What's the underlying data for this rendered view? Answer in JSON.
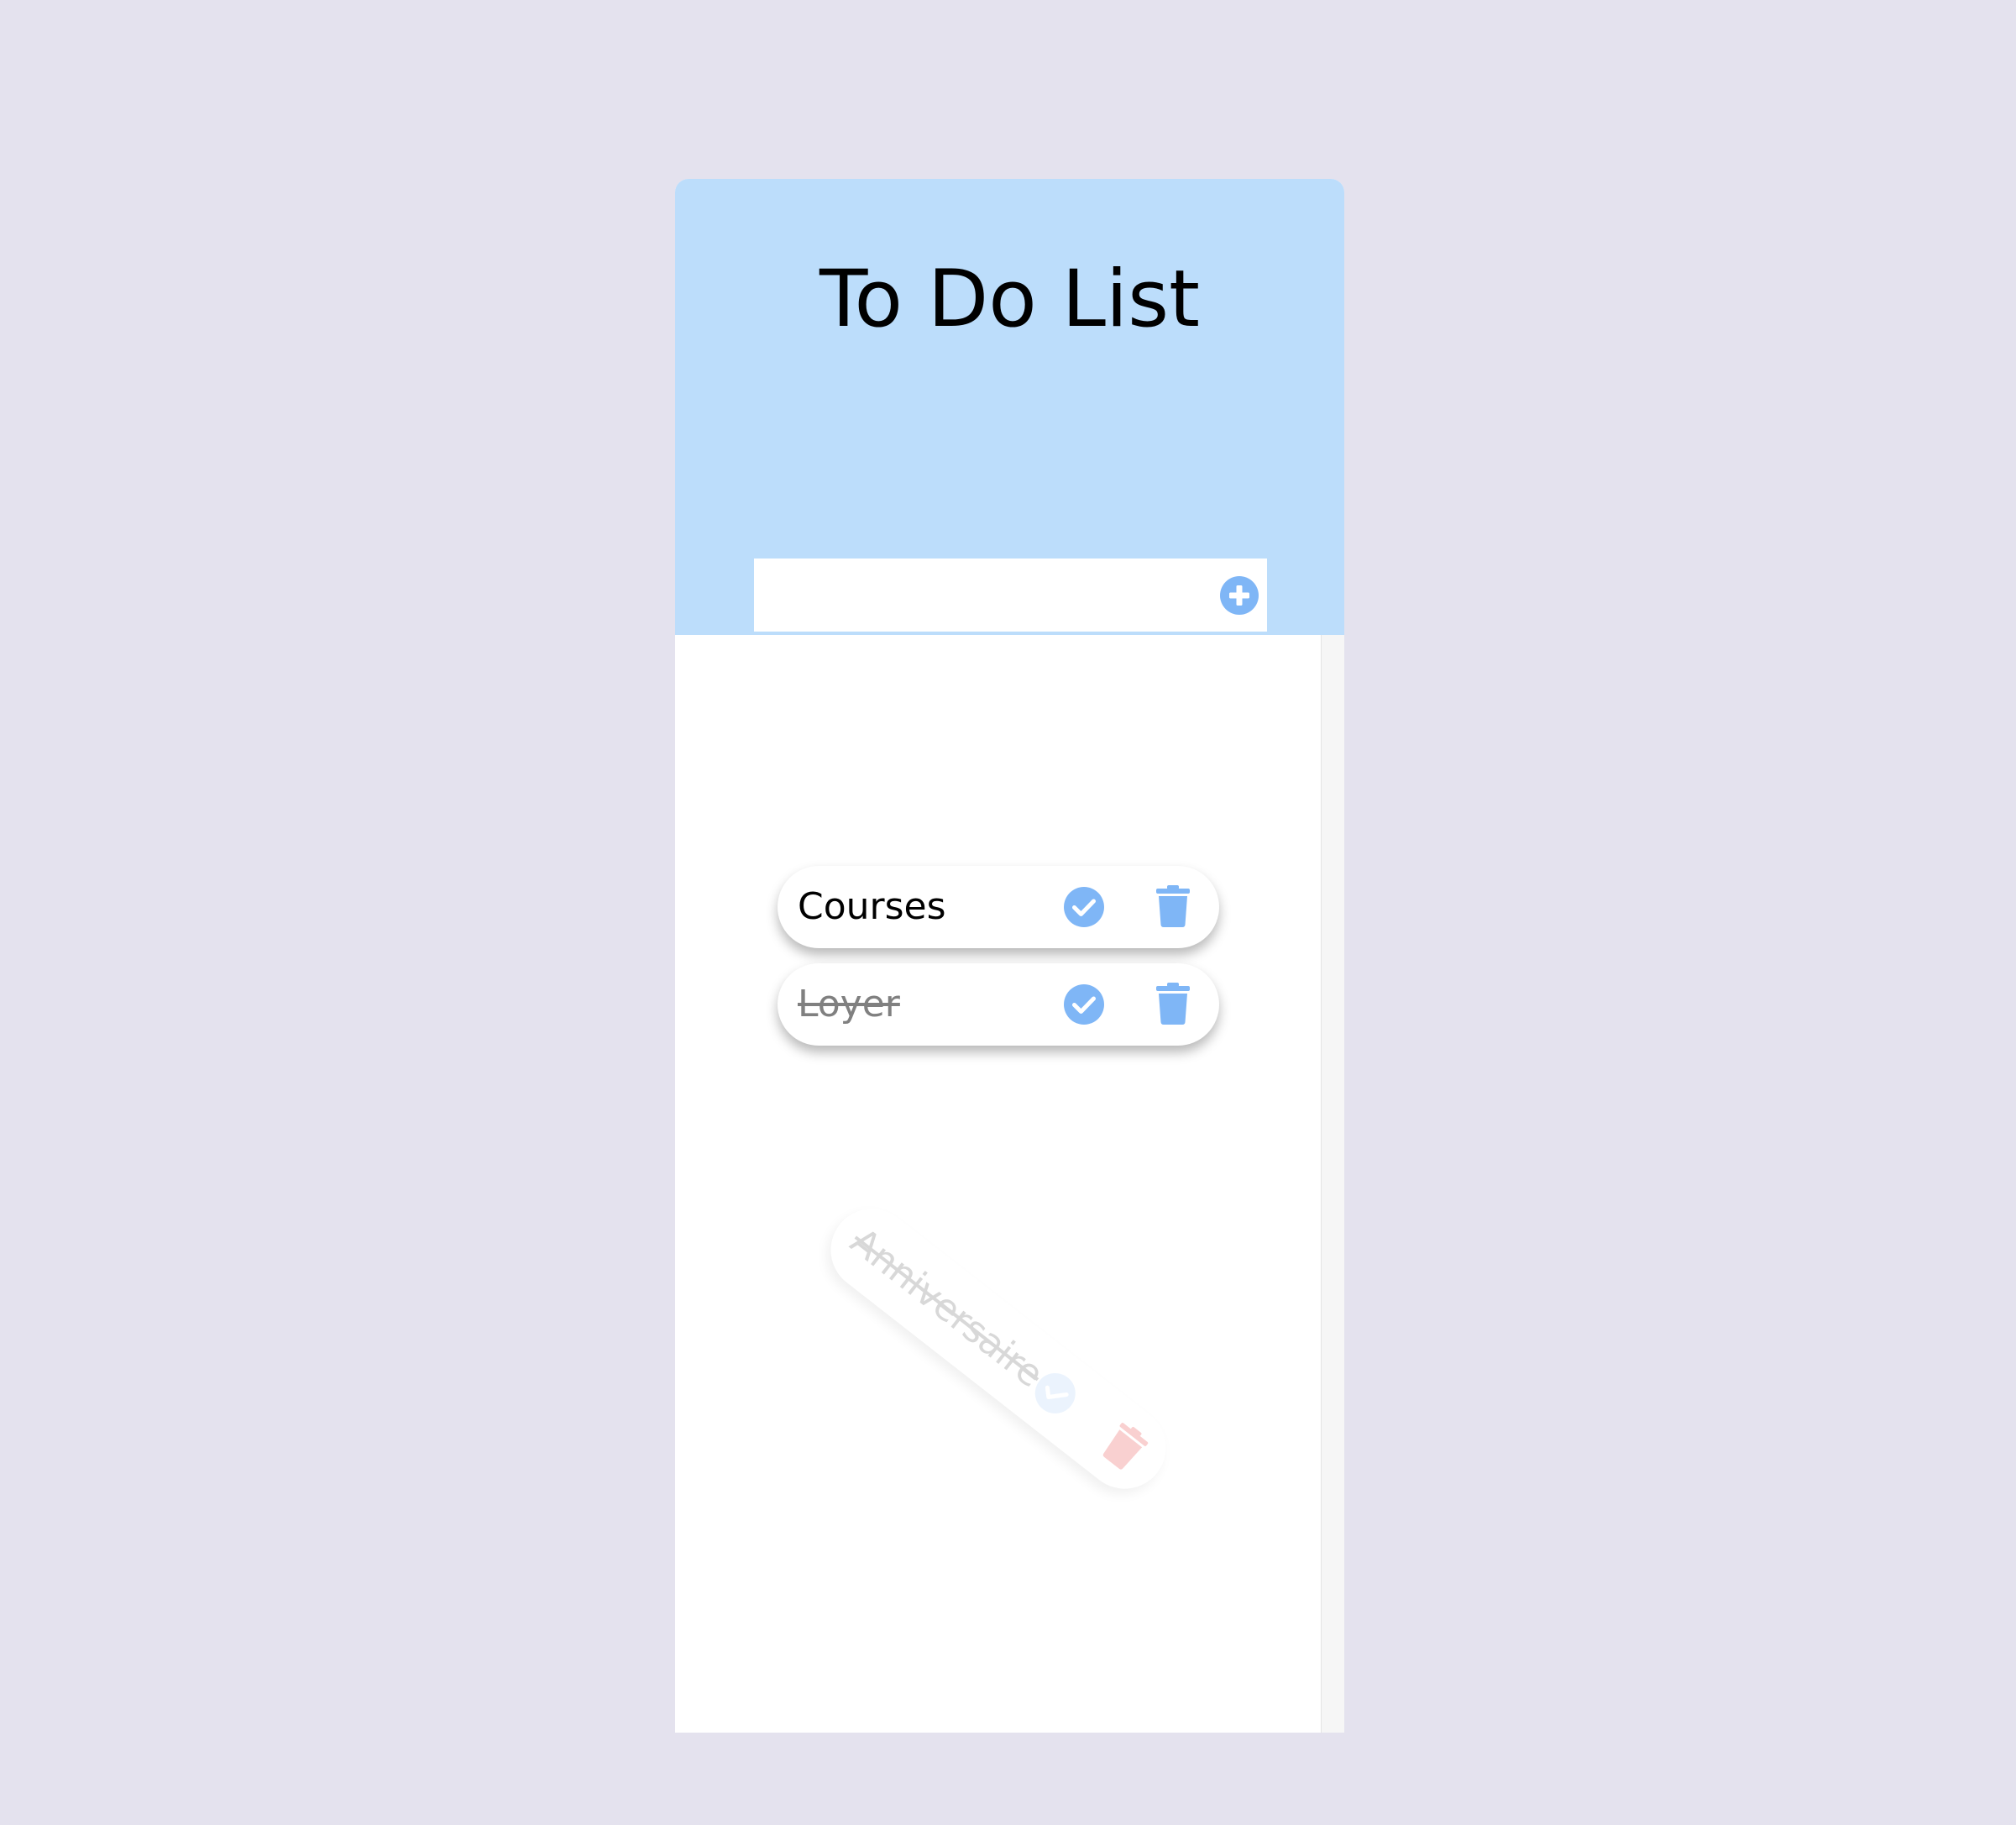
{
  "header": {
    "title": "To Do List"
  },
  "add_bar": {
    "input_value": "",
    "add_icon": "plus-circle-icon"
  },
  "tasks": [
    {
      "label": "Courses",
      "done": false
    },
    {
      "label": "Loyer",
      "done": true
    },
    {
      "label": "Anniversaire",
      "done": true,
      "state": "being removed (fading, rotated)"
    }
  ],
  "icons": {
    "check": "check-circle-icon",
    "delete": "trash-icon"
  },
  "colors": {
    "page_background": "#e4e2ee",
    "header_background": "#bcddfb",
    "accent_blue": "#7fb6f6",
    "delete_red_fading": "#f5a5a5",
    "completed_text": "#808080"
  }
}
